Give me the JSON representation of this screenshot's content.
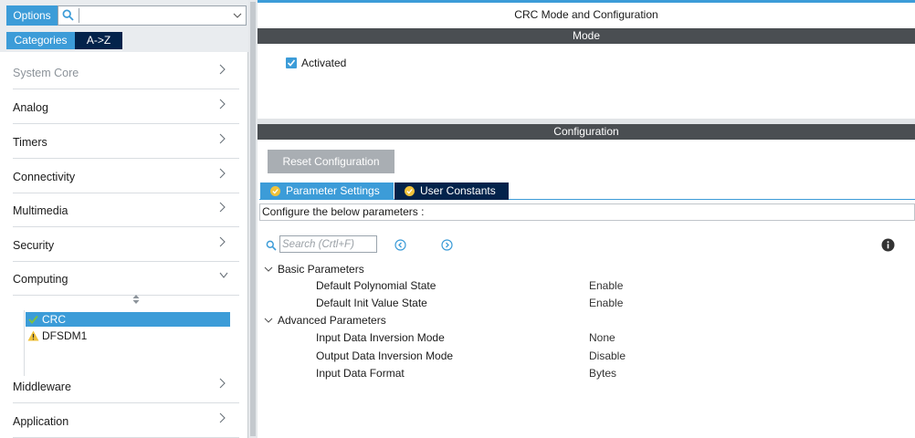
{
  "left_panel": {
    "options_label": "Options",
    "search_value": "",
    "tabs": {
      "categories": "Categories",
      "az": "A->Z"
    },
    "categories": [
      {
        "label": "System Core",
        "state": "collapsed",
        "dim": true
      },
      {
        "label": "Analog",
        "state": "collapsed"
      },
      {
        "label": "Timers",
        "state": "collapsed"
      },
      {
        "label": "Connectivity",
        "state": "collapsed"
      },
      {
        "label": "Multimedia",
        "state": "collapsed"
      },
      {
        "label": "Security",
        "state": "collapsed"
      },
      {
        "label": "Computing",
        "state": "expanded"
      },
      {
        "label": "Middleware",
        "state": "collapsed"
      },
      {
        "label": "Application",
        "state": "collapsed"
      }
    ],
    "computing_items": [
      {
        "label": "CRC",
        "icon": "check-icon",
        "selected": true
      },
      {
        "label": "DFSDM1",
        "icon": "warning-icon",
        "selected": false
      }
    ]
  },
  "main": {
    "title": "CRC Mode and Configuration",
    "mode_header": "Mode",
    "activated_label": "Activated",
    "activated_checked": true,
    "configuration_header": "Configuration",
    "reset_button": "Reset Configuration",
    "tabs": [
      {
        "label": "Parameter Settings",
        "active": true
      },
      {
        "label": "User Constants",
        "active": false
      }
    ],
    "hint": "Configure the below parameters :",
    "search_placeholder": "Search (Crtl+F)",
    "groups": [
      {
        "label": "Basic Parameters",
        "params": [
          {
            "name": "Default Polynomial State",
            "value": "Enable"
          },
          {
            "name": "Default Init Value State",
            "value": "Enable"
          }
        ]
      },
      {
        "label": "Advanced Parameters",
        "params": [
          {
            "name": "Input Data Inversion Mode",
            "value": "None"
          },
          {
            "name": "Output Data Inversion Mode",
            "value": "Disable"
          },
          {
            "name": "Input Data Format",
            "value": "Bytes"
          }
        ]
      }
    ]
  },
  "colors": {
    "accent": "#3c9cd8",
    "navy": "#03234b",
    "header_dark": "#4a4e52",
    "button_gray": "#a9aeb3",
    "warning": "#f0c23a",
    "ok_green": "#7cc142"
  }
}
